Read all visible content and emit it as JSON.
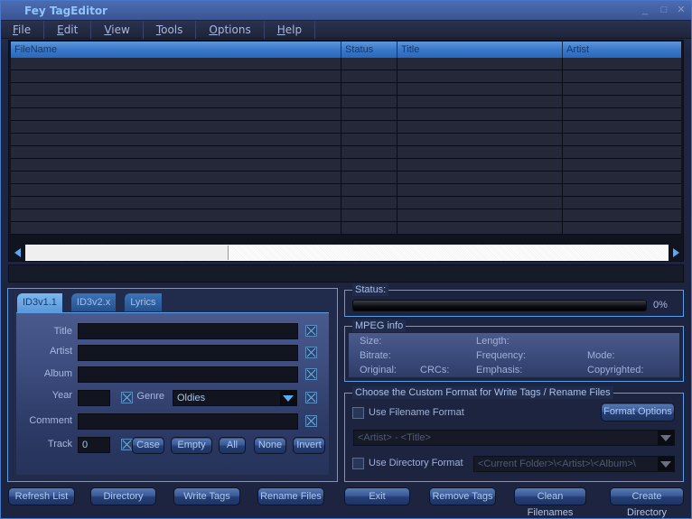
{
  "window": {
    "title": "Fey TagEditor",
    "controls": {
      "minimize": "_",
      "maximize": "□",
      "close": "✕"
    }
  },
  "menu": [
    {
      "label": "File",
      "mnemonic": "F"
    },
    {
      "label": "Edit",
      "mnemonic": "E"
    },
    {
      "label": "View",
      "mnemonic": "V"
    },
    {
      "label": "Tools",
      "mnemonic": "T"
    },
    {
      "label": "Options",
      "mnemonic": "O"
    },
    {
      "label": "Help",
      "mnemonic": "H"
    }
  ],
  "file_list": {
    "columns": [
      "FileName",
      "Status",
      "Title",
      "Artist"
    ],
    "rows": []
  },
  "status_line": "",
  "tag_panel": {
    "tabs": [
      "ID3v1.1",
      "ID3v2.x",
      "Lyrics"
    ],
    "active_tab": "ID3v1.1",
    "fields": {
      "title": {
        "label": "Title",
        "value": ""
      },
      "artist": {
        "label": "Artist",
        "value": ""
      },
      "album": {
        "label": "Album",
        "value": ""
      },
      "year": {
        "label": "Year",
        "value": ""
      },
      "genre": {
        "label": "Genre",
        "value": "Oldies"
      },
      "comment": {
        "label": "Comment",
        "value": ""
      },
      "track": {
        "label": "Track",
        "value": "0"
      }
    },
    "buttons": [
      "Case",
      "Empty",
      "All",
      "None",
      "Invert"
    ]
  },
  "status_group": {
    "legend": "Status:",
    "progress_percent": 0,
    "progress_text": "0%"
  },
  "mpeg_info": {
    "legend": "MPEG info",
    "labels": {
      "size": "Size:",
      "length": "Length:",
      "bitrate": "Bitrate:",
      "frequency": "Frequency:",
      "mode": "Mode:",
      "original": "Original:",
      "crcs": "CRCs:",
      "emphasis": "Emphasis:",
      "copyrighted": "Copyrighted:"
    }
  },
  "format_group": {
    "legend": "Choose the Custom Format for Write Tags / Rename Files",
    "use_filename_format": {
      "label": "Use Filename Format",
      "checked": false
    },
    "format_options_label": "Format Options",
    "filename_format_value": "<Artist> - <Title>",
    "use_directory_format": {
      "label": "Use Directory Format",
      "checked": false
    },
    "directory_format_value": "<Current Folder>\\<Artist>\\<Album>\\"
  },
  "bottom_buttons": [
    "Refresh List",
    "Directory",
    "Write Tags",
    "Rename Files",
    "Exit",
    "Remove Tags",
    "Clean Filenames",
    "Create Directory"
  ]
}
